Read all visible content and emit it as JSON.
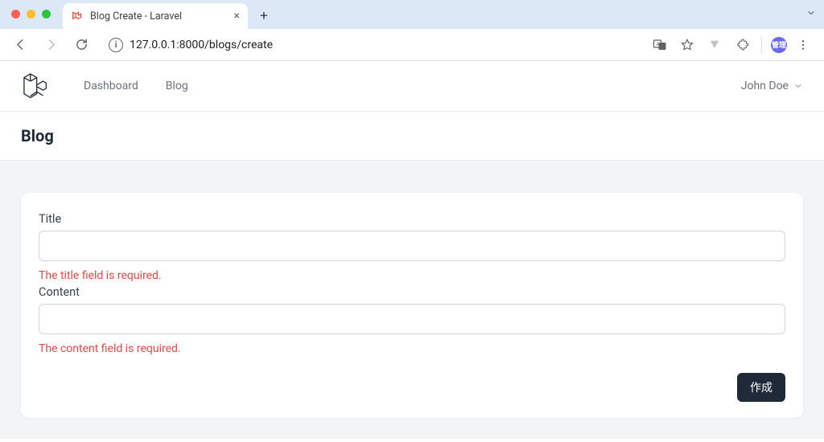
{
  "browser": {
    "tab_title": "Blog Create - Laravel",
    "url": "127.0.0.1:8000/blogs/create",
    "avatar_text": "管理"
  },
  "nav": {
    "links": [
      "Dashboard",
      "Blog"
    ],
    "user_name": "John Doe"
  },
  "header": {
    "title": "Blog"
  },
  "form": {
    "title_label": "Title",
    "title_value": "",
    "title_error": "The title field is required.",
    "content_label": "Content",
    "content_value": "",
    "content_error": "The content field is required.",
    "submit_label": "作成"
  }
}
